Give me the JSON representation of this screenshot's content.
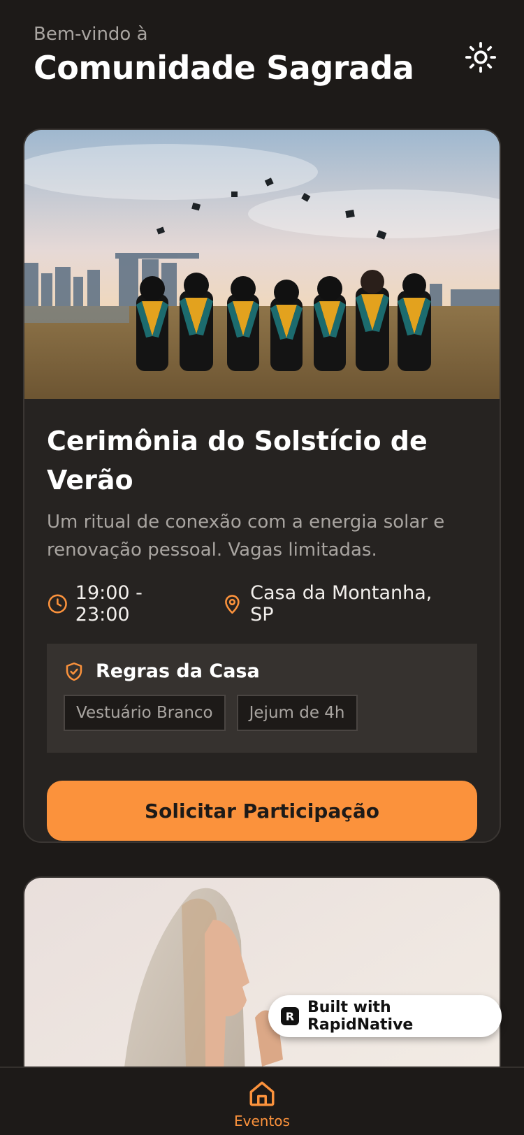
{
  "header": {
    "greeting": "Bem-vindo à",
    "title": "Comunidade Sagrada",
    "theme_icon": "sun-icon"
  },
  "events": [
    {
      "title": "Cerimônia do Solstício de Verão",
      "description": "Um ritual de conexão com a energia solar e renovação pessoal. Vagas limitadas.",
      "time": "19:00 - 23:00",
      "location": "Casa da Montanha, SP",
      "rules_title": "Regras da Casa",
      "rules": [
        "Vestuário Branco",
        "Jejum de 4h"
      ],
      "cta_label": "Solicitar Participação"
    }
  ],
  "badge": {
    "label": "Built with RapidNative"
  },
  "nav": {
    "items": [
      {
        "label": "Eventos",
        "icon": "home-icon"
      }
    ]
  },
  "colors": {
    "accent": "#fb923c",
    "background": "#1d1a18",
    "card": "#262321"
  }
}
